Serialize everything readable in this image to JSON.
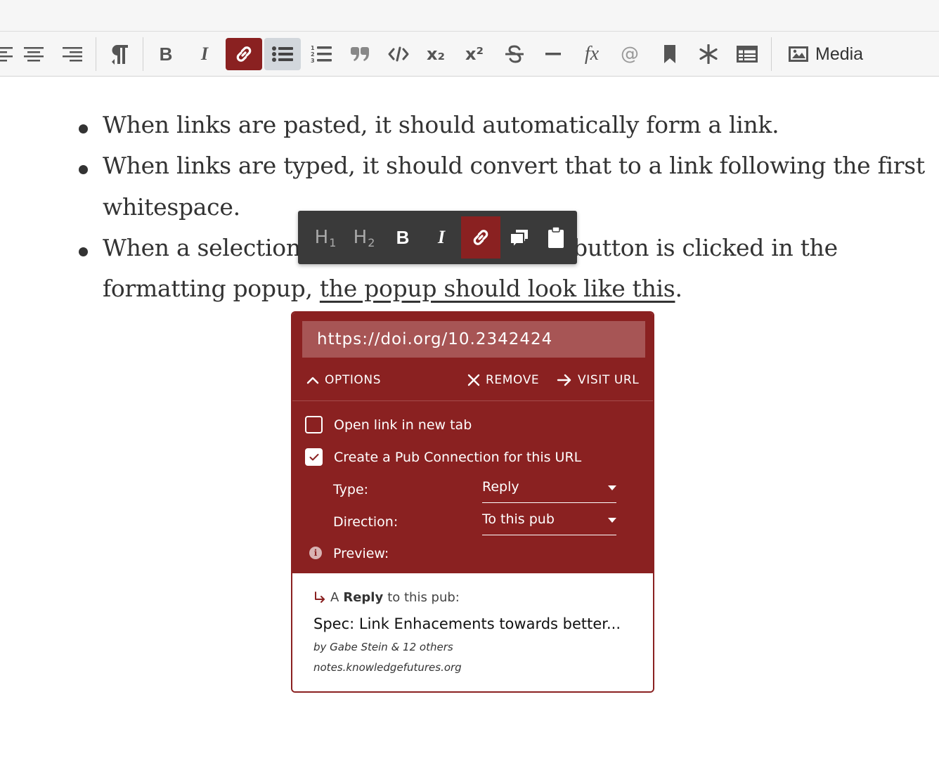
{
  "toolbar": {
    "items": [
      "align-left",
      "align-center",
      "align-right",
      "paragraph",
      "bold",
      "italic",
      "link",
      "bullet-list",
      "ordered-list",
      "blockquote",
      "code",
      "subscript",
      "superscript",
      "strikethrough",
      "horizontal-rule",
      "equation",
      "mention",
      "bookmark",
      "footnote",
      "table"
    ],
    "bold_label": "B",
    "italic_label": "I",
    "subscript_label": "x₂",
    "superscript_label": "x²",
    "fx_label": "fx",
    "mention_label": "@",
    "media_label": "Media",
    "active_color": "#8a2121"
  },
  "content": {
    "bullet1": "When links are pasted, it should automatically form a link.",
    "bullet2_line1": "When links are typed, it should convert that to a link following the first",
    "bullet2_line2": "whitespace.",
    "bullet3_line1_start": "When a selection is",
    "bullet3_line1_end": "button is clicked in the",
    "bullet3_line2_start": "formatting popup, ",
    "bullet3_link": "the popup should look like this",
    "bullet3_line2_end": "."
  },
  "format_popup": {
    "h1_label": "H",
    "h1_sub": "1",
    "h2_label": "H",
    "h2_sub": "2",
    "bold_label": "B",
    "italic_label": "I"
  },
  "link_popup": {
    "url": "https://doi.org/10.2342424",
    "options_label": "OPTIONS",
    "remove_label": "REMOVE",
    "visit_label": "VISIT URL",
    "open_new_tab_label": "Open link in new tab",
    "open_new_tab_checked": false,
    "pub_connection_label": "Create a Pub Connection for this URL",
    "pub_connection_checked": true,
    "type_label": "Type:",
    "type_value": "Reply",
    "direction_label": "Direction:",
    "direction_value": "To this pub",
    "preview_label": "Preview:",
    "info_icon": "i"
  },
  "preview": {
    "prefix": "A",
    "type": "Reply",
    "suffix": "to this pub:",
    "title": "Spec: Link Enhacements towards better...",
    "byline": "by Gabe Stein & 12 others",
    "domain": "notes.knowledgefutures.org"
  }
}
